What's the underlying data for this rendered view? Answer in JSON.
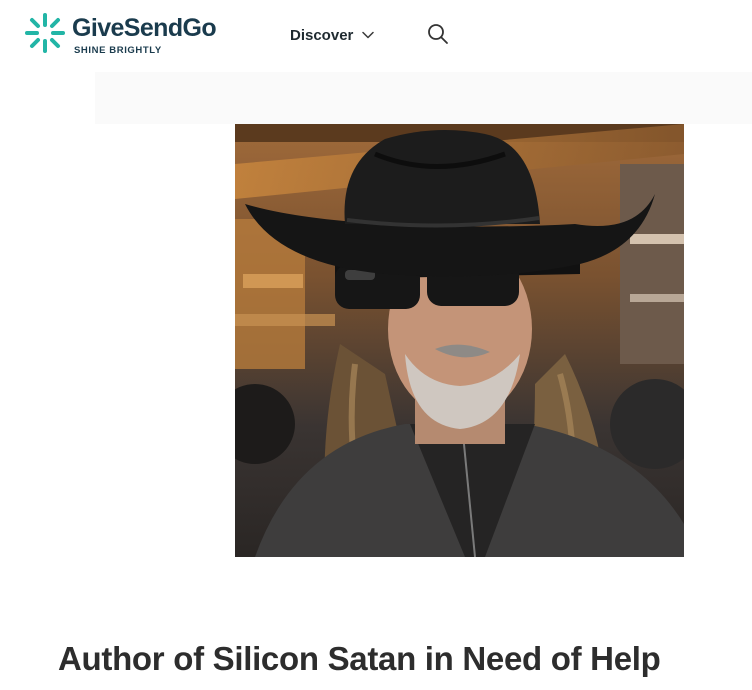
{
  "header": {
    "brand_name": "GiveSendGo",
    "brand_tagline": "SHINE BRIGHTLY",
    "nav": {
      "discover_label": "Discover"
    },
    "icons": {
      "logo": "sparkle-logo-icon",
      "discover_caret": "chevron-down-icon",
      "search": "search-icon"
    }
  },
  "campaign": {
    "image_alt": "Man in black cowboy hat and sunglasses",
    "title": "Author of Silicon Satan in Need of Help"
  },
  "colors": {
    "brand_teal": "#22b5a6",
    "brand_navy": "#1a3b4d",
    "title_text": "#2d2d2d"
  }
}
